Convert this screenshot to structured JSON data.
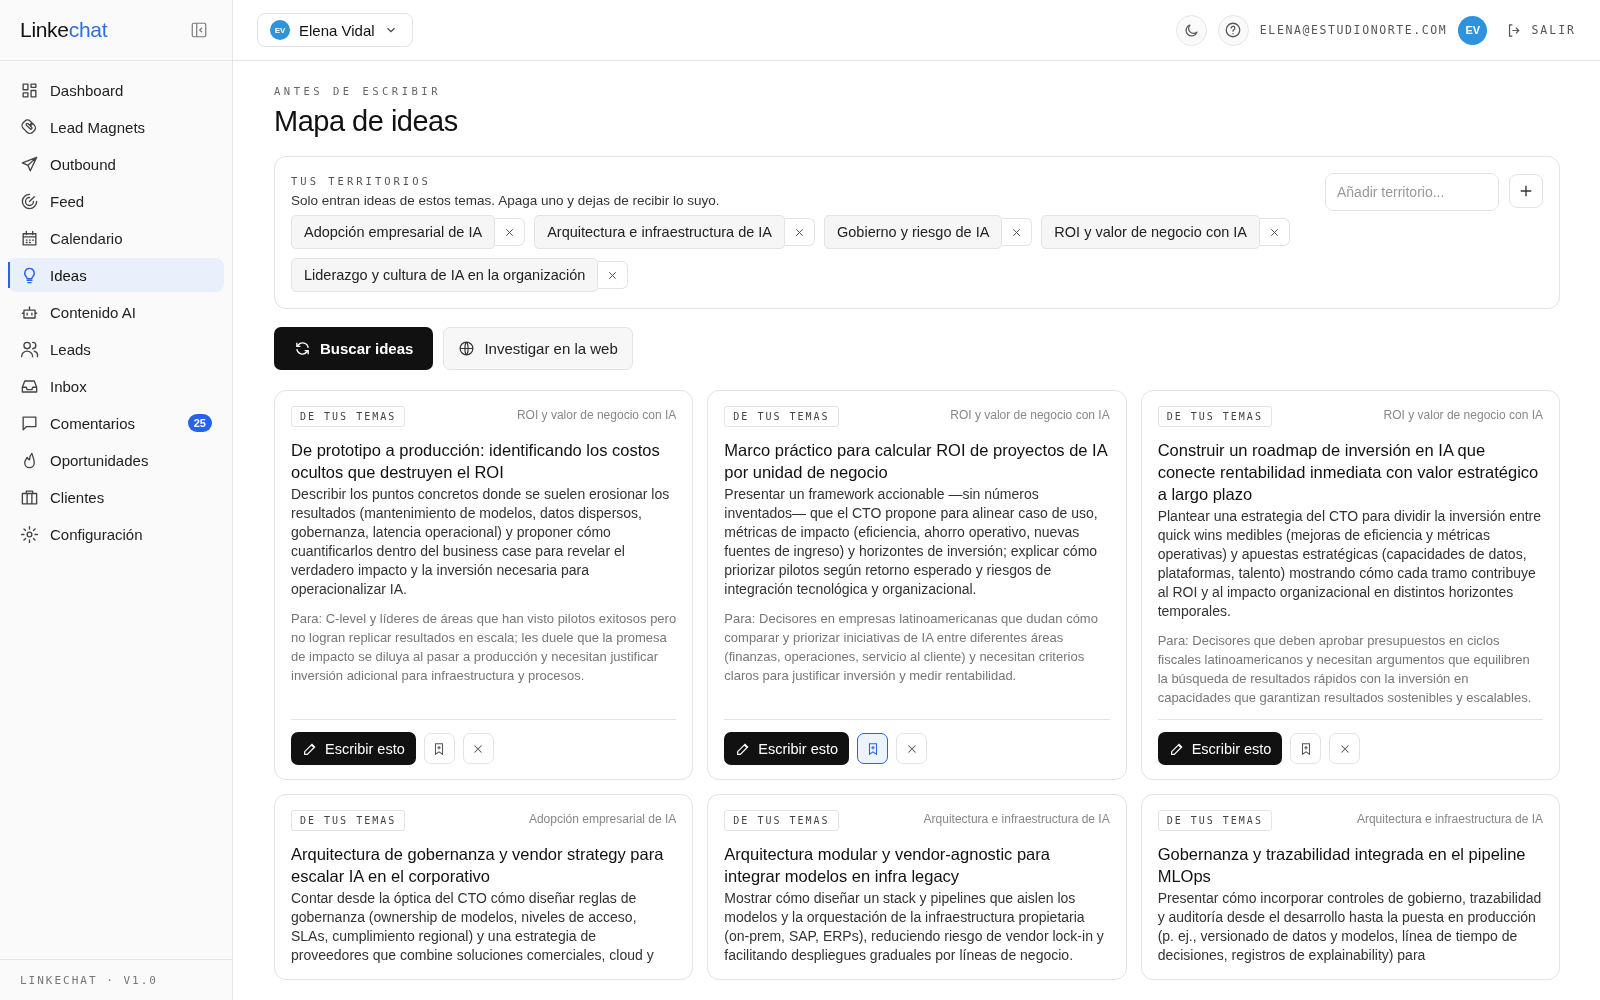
{
  "sidebar": {
    "logo": {
      "part_1": "Linke",
      "part_2": "chat"
    },
    "items": [
      {
        "label": "Dashboard",
        "selected": false
      },
      {
        "label": "Lead Magnets",
        "selected": false
      },
      {
        "label": "Outbound",
        "selected": false
      },
      {
        "label": "Feed",
        "selected": false
      },
      {
        "label": "Calendario",
        "selected": false
      },
      {
        "label": "Ideas",
        "selected": true
      },
      {
        "label": "Contenido AI",
        "selected": false
      },
      {
        "label": "Leads",
        "selected": false
      },
      {
        "label": "Inbox",
        "selected": false
      },
      {
        "label": "Comentarios",
        "selected": false,
        "badge": "25"
      },
      {
        "label": "Oportunidades",
        "selected": false
      },
      {
        "label": "Clientes",
        "selected": false
      },
      {
        "label": "Configuración",
        "selected": false
      }
    ],
    "footer": "LINKECHAT · V1.0"
  },
  "header": {
    "account": {
      "initials": "EV",
      "name": "Elena Vidal"
    },
    "email": "ELENA@ESTUDIONORTE.COM",
    "user_initials": "EV",
    "logout": "SALIR"
  },
  "page": {
    "eyebrow": "ANTES DE ESCRIBIR",
    "title": "Mapa de ideas"
  },
  "territories": {
    "heading": "TUS TERRITORIOS",
    "description": "Solo entran ideas de estos temas. Apaga uno y dejas de recibir lo suyo.",
    "input_placeholder": "Añadir territorio...",
    "chips": [
      "Adopción empresarial de IA",
      "Arquitectura e infraestructura de IA",
      "Gobierno y riesgo de IA",
      "ROI y valor de negocio con IA",
      "Liderazgo y cultura de IA en la organización"
    ]
  },
  "actions": {
    "primary": "Buscar ideas",
    "secondary": "Investigar en la web"
  },
  "ideas": [
    {
      "tag": "DE TUS TEMAS",
      "topic": "ROI y valor de negocio con IA",
      "title": "De prototipo a producción: identificando los costos ocultos que destruyen el ROI",
      "description": "Describir los puntos concretos donde se suelen erosionar los resultados (mantenimiento de modelos, datos dispersos, gobernanza, latencia operacional) y proponer cómo cuantificarlos dentro del business case para revelar el verdadero impacto y la inversión necesaria para operacionalizar IA.",
      "audience": "Para: C-level y líderes de áreas que han visto pilotos exitosos pero no logran replicar resultados en escala; les duele que la promesa de impacto se diluya al pasar a producción y necesitan justificar inversión adicional para infraestructura y procesos.",
      "write_label": "Escribir esto",
      "saved": false
    },
    {
      "tag": "DE TUS TEMAS",
      "topic": "ROI y valor de negocio con IA",
      "title": "Marco práctico para calcular ROI de proyectos de IA por unidad de negocio",
      "description": "Presentar un framework accionable —sin números inventados— que el CTO propone para alinear caso de uso, métricas de impacto (eficiencia, ahorro operativo, nuevas fuentes de ingreso) y horizontes de inversión; explicar cómo priorizar pilotos según retorno esperado y riesgos de integración tecnológica y organizacional.",
      "audience": "Para: Decisores en empresas latinoamericanas que dudan cómo comparar y priorizar iniciativas de IA entre diferentes áreas (finanzas, operaciones, servicio al cliente) y necesitan criterios claros para justificar inversión y medir rentabilidad.",
      "write_label": "Escribir esto",
      "saved": true
    },
    {
      "tag": "DE TUS TEMAS",
      "topic": "ROI y valor de negocio con IA",
      "title": "Construir un roadmap de inversión en IA que conecte rentabilidad inmediata con valor estratégico a largo plazo",
      "description": "Plantear una estrategia del CTO para dividir la inversión entre quick wins medibles (mejoras de eficiencia y métricas operativas) y apuestas estratégicas (capacidades de datos, plataformas, talento) mostrando cómo cada tramo contribuye al ROI y al impacto organizacional en distintos horizontes temporales.",
      "audience": "Para: Decisores que deben aprobar presupuestos en ciclos fiscales latinoamericanos y necesitan argumentos que equilibren la búsqueda de resultados rápidos con la inversión en capacidades que garantizan resultados sostenibles y escalables.",
      "write_label": "Escribir esto",
      "saved": false
    },
    {
      "tag": "DE TUS TEMAS",
      "topic": "Adopción empresarial de IA",
      "title": "Arquitectura de gobernanza y vendor strategy para escalar IA en el corporativo",
      "description": "Contar desde la óptica del CTO cómo diseñar reglas de gobernanza (ownership de modelos, niveles de acceso, SLAs, cumplimiento regional) y una estrategia de proveedores que combine soluciones comerciales, cloud y"
    },
    {
      "tag": "DE TUS TEMAS",
      "topic": "Arquitectura e infraestructura de IA",
      "title": "Arquitectura modular y vendor-agnostic para integrar modelos en infra legacy",
      "description": "Mostrar cómo diseñar un stack y pipelines que aislen los modelos y la orquestación de la infraestructura propietaria (on-prem, SAP, ERPs), reduciendo riesgo de vendor lock-in y facilitando despliegues graduales por líneas de negocio."
    },
    {
      "tag": "DE TUS TEMAS",
      "topic": "Arquitectura e infraestructura de IA",
      "title": "Gobernanza y trazabilidad integrada en el pipeline MLOps",
      "description": "Presentar cómo incorporar controles de gobierno, trazabilidad y auditoría desde el desarrollo hasta la puesta en producción (p. ej., versionado de datos y modelos, línea de tiempo de decisiones, registros de explainability) para"
    }
  ]
}
